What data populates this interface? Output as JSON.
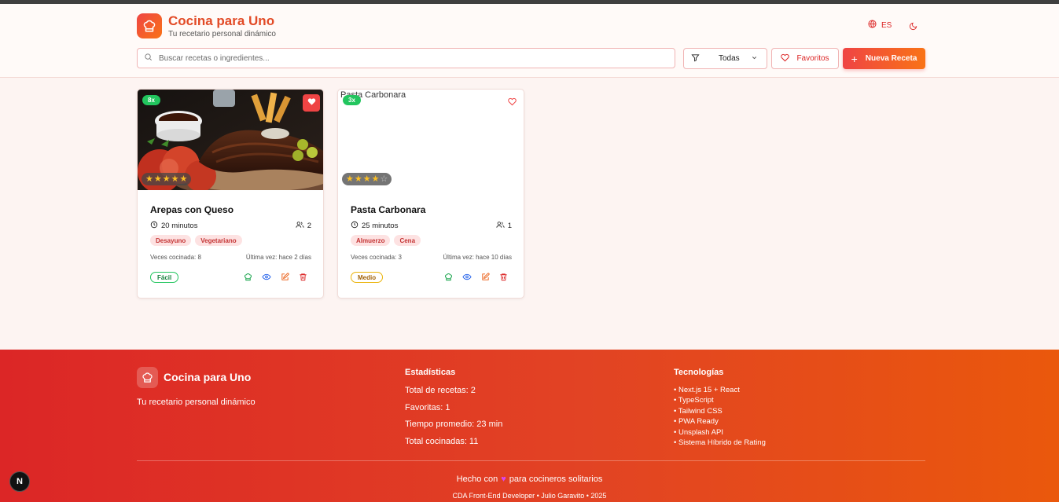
{
  "header": {
    "title": "Cocina para Uno",
    "subtitle": "Tu recetario personal dinámico",
    "language": "ES",
    "logo_icon": "chef-hat-icon",
    "accent_color": "#e24a26"
  },
  "toolbar": {
    "search_placeholder": "Buscar recetas o ingredientes...",
    "filter_value": "Todas",
    "favorites_label": "Favoritos",
    "new_recipe_label": "Nueva Receta"
  },
  "recipes": [
    {
      "title": "Arepas con Queso",
      "image_alt": "",
      "times_cooked_badge": "8x",
      "favorite": true,
      "rating": 5,
      "time": "20 minutos",
      "servings": "2",
      "tags": [
        "Desayuno",
        "Vegetariano"
      ],
      "cooked_text": "Veces cocinada: 8",
      "last_text": "Última vez: hace 2 días",
      "difficulty": "Fácil"
    },
    {
      "title": "Pasta Carbonara",
      "image_alt": "Pasta Carbonara",
      "times_cooked_badge": "3x",
      "favorite": false,
      "rating": 4,
      "time": "25 minutos",
      "servings": "1",
      "tags": [
        "Almuerzo",
        "Cena"
      ],
      "cooked_text": "Veces cocinada: 3",
      "last_text": "Última vez: hace 10 días",
      "difficulty": "Medio"
    }
  ],
  "footer": {
    "brand": "Cocina para Uno",
    "tagline": "Tu recetario personal dinámico",
    "stats_heading": "Estadísticas",
    "stats": [
      "Total de recetas: 2",
      "Favoritas: 1",
      "Tiempo promedio: 23 min",
      "Total cocinadas: 11"
    ],
    "tech_heading": "Tecnologías",
    "tech": [
      "• Next.js 15 + React",
      "• TypeScript",
      "• Tailwind CSS",
      "• PWA Ready",
      "• Unsplash API",
      "• Sistema Híbrido de Rating"
    ],
    "made_prefix": "Hecho con",
    "made_heart": "♥",
    "made_suffix": "para cocineros solitarios",
    "credit": "CDA Front-End Developer • Julio Garavito • 2025"
  },
  "dev_badge": "N"
}
